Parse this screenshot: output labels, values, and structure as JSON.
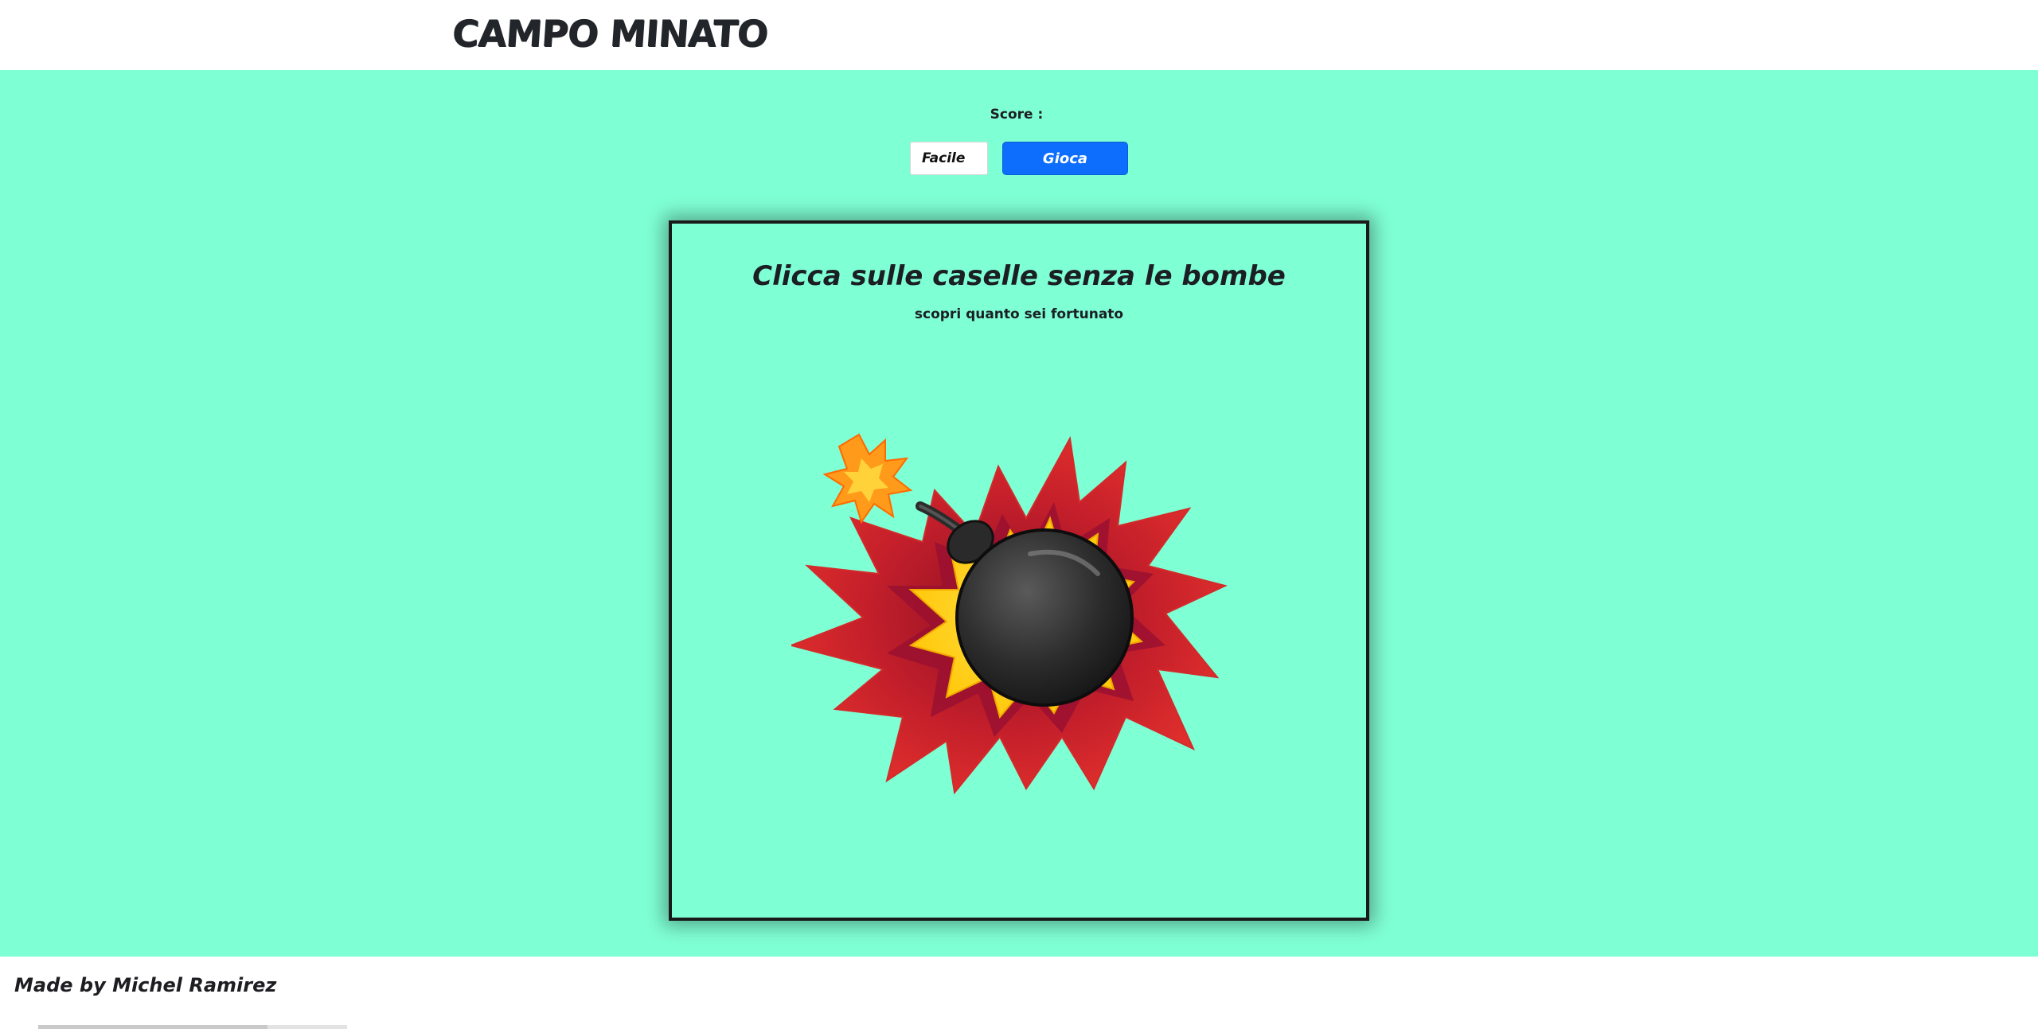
{
  "header": {
    "title": "CAMPO MINATO"
  },
  "main": {
    "score_label": "Score :",
    "score_value": "",
    "difficulty": {
      "selected": "Facile"
    },
    "play_button_label": "Gioca",
    "board": {
      "title": "Clicca sulle caselle senza le bombe",
      "subtitle": "scopri quanto sei fortunato",
      "image_icon": "bomb-explosion-icon"
    }
  },
  "footer": {
    "credit": "Made by Michel Ramirez"
  },
  "colors": {
    "background": "#7fffd4",
    "header_bg": "#ffffff",
    "footer_bg": "#ffffff",
    "button_primary": "#0d6efd",
    "text_dark": "#1d1d22",
    "board_border": "#1a1a1a"
  }
}
